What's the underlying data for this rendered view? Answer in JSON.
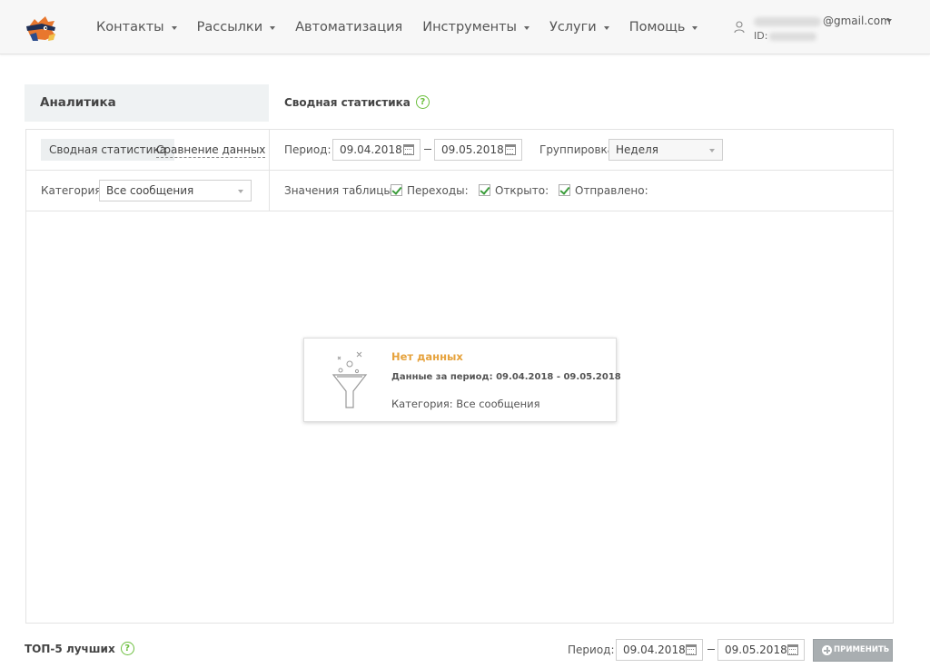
{
  "nav": {
    "items": [
      {
        "label": "Контакты",
        "dropdown": true
      },
      {
        "label": "Рассылки",
        "dropdown": true
      },
      {
        "label": "Автоматизация",
        "dropdown": false
      },
      {
        "label": "Инструменты",
        "dropdown": true
      },
      {
        "label": "Услуги",
        "dropdown": true
      },
      {
        "label": "Помощь",
        "dropdown": true
      }
    ],
    "user": {
      "email_suffix": "@gmail.com",
      "id_prefix": "ID:"
    }
  },
  "sidebar": {
    "title": "Аналитика"
  },
  "main": {
    "title": "Сводная статистика",
    "help": "?"
  },
  "tabs": {
    "summary": "Сводная статистика",
    "compare": "Сравнение данных"
  },
  "filters": {
    "period_label": "Период:",
    "date_from": "09.04.2018",
    "date_to": "09.05.2018",
    "grouping_label": "Группировка",
    "grouping_value": "Неделя",
    "category_label": "Категория",
    "category_value": "Все сообщения",
    "table_values_label": "Значения таблицы:",
    "checks": [
      {
        "label": "Переходы:",
        "checked": true
      },
      {
        "label": "Открыто:",
        "checked": true
      },
      {
        "label": "Отправлено:",
        "checked": true
      }
    ]
  },
  "empty": {
    "title": "Нет данных",
    "period": "Данные за период: 09.04.2018 - 09.05.2018",
    "category": "Категория: Все сообщения"
  },
  "footer": {
    "top5_title": "ТОП-5 лучших",
    "help": "?",
    "period_label": "Период:",
    "date_from": "09.04.2018",
    "date_to": "09.05.2018",
    "apply_label": "ПРИМЕНИТЬ"
  },
  "colors": {
    "accent_green": "#6cbf3e",
    "empty_title": "#e6a23c",
    "apply_button": "#a9aeb1"
  }
}
